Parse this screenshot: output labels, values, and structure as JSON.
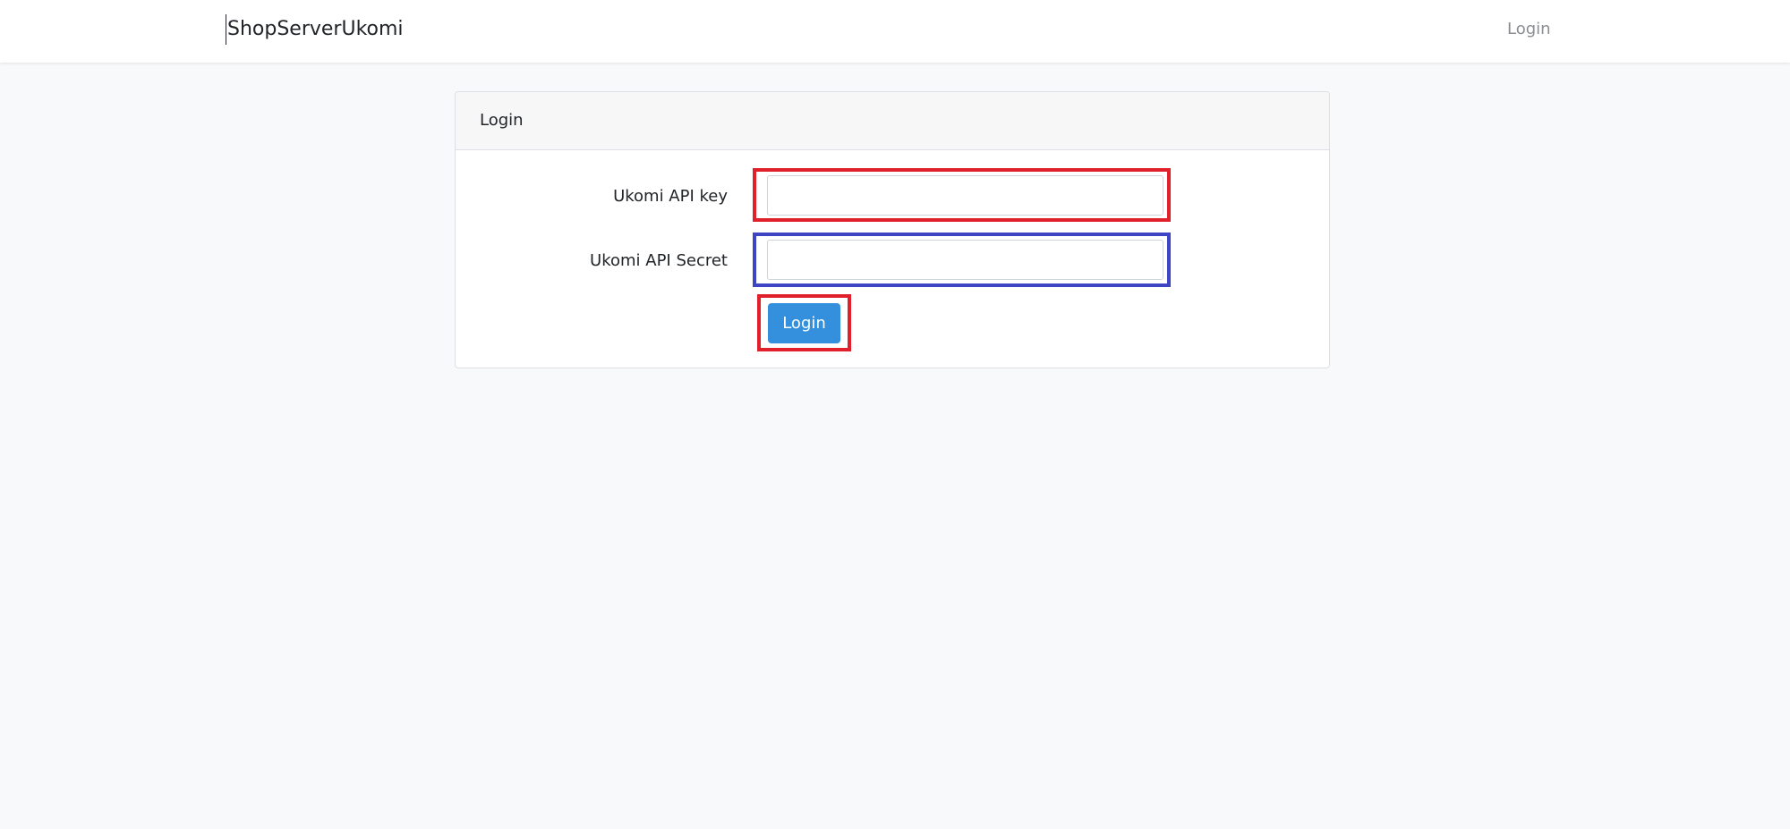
{
  "navbar": {
    "brand": "ShopServerUkomi",
    "login_link": "Login"
  },
  "login_card": {
    "header": "Login",
    "api_key": {
      "label": "Ukomi API key",
      "value": "",
      "placeholder": ""
    },
    "api_secret": {
      "label": "Ukomi API Secret",
      "value": "",
      "placeholder": ""
    },
    "submit_label": "Login"
  },
  "colors": {
    "page_background": "#f8f9fb",
    "primary_button": "#3490dc",
    "highlight_red": "#e0202b",
    "highlight_blue": "#3e45c4"
  }
}
